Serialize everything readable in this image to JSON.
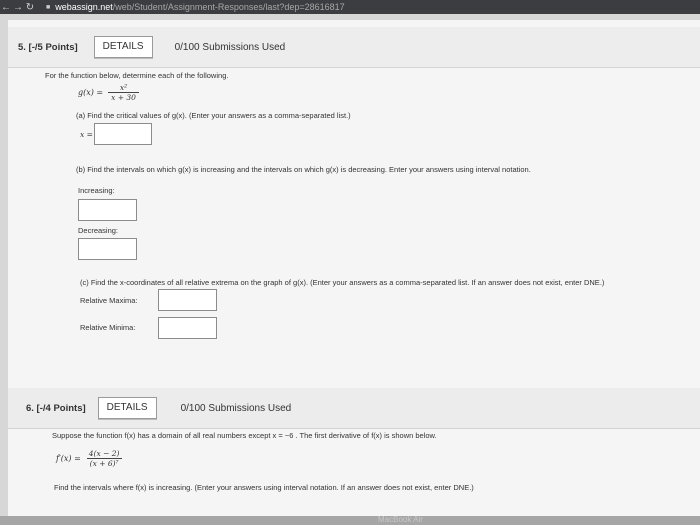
{
  "browser": {
    "back_glyph": "←",
    "forward_glyph": "→",
    "reload_glyph": "↻",
    "lock_glyph": "■",
    "url_domain": "webassign.net",
    "url_path": "/web/Student/Assignment-Responses/last?dep=28616817"
  },
  "q5": {
    "number": "5. [-/5 Points]",
    "details": "DETAILS",
    "submissions": "0/100 Submissions Used",
    "intro": "For the function below, determine each of the following.",
    "g_lhs": "g(x) =",
    "g_num": "x²",
    "g_den": "x + 30",
    "part_a": "(a) Find the critical values of g(x). (Enter your answers as a comma-separated list.)",
    "x_label": "x =",
    "part_b": "(b) Find the intervals on which g(x) is increasing and the intervals on which g(x) is decreasing. Enter your answers using interval notation.",
    "increasing": "Increasing:",
    "decreasing": "Decreasing:",
    "part_c": "(c) Find the x-coordinates of all relative extrema on the graph of g(x). (Enter your answers as a comma-separated list. If an answer does not exist, enter DNE.)",
    "rel_max": "Relative Maxima:",
    "rel_min": "Relative Minima:"
  },
  "q6": {
    "number": "6. [-/4 Points]",
    "details": "DETAILS",
    "submissions": "0/100 Submissions Used",
    "intro": "Suppose the function f(x) has a domain of all real numbers except x = −6 . The first derivative of f(x) is shown below.",
    "f_lhs": "f′(x) =",
    "f_num": "4(x − 2)",
    "f_den": "(x + 6)⁷",
    "find": "Find the intervals where f(x) is increasing. (Enter your answers using interval notation. If an answer does not exist, enter DNE.)"
  },
  "device": {
    "watermark": "MacBook Air"
  }
}
